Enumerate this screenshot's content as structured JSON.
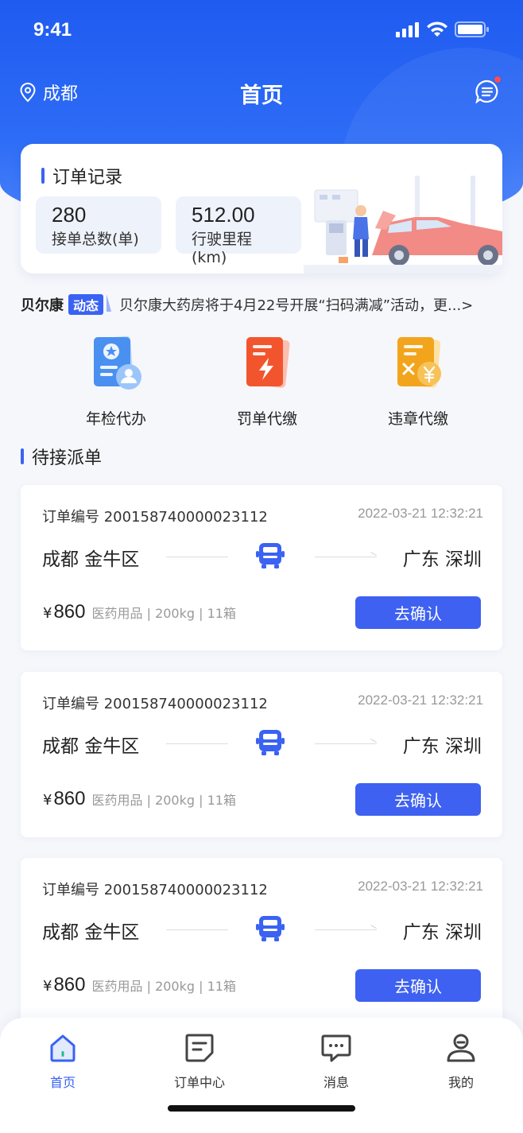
{
  "status": {
    "time": "9:41"
  },
  "nav": {
    "location": "成都",
    "title": "首页"
  },
  "record": {
    "title": "订单记录",
    "stats": [
      {
        "value": "280",
        "label": "接单总数(单)"
      },
      {
        "value": "512.00",
        "label": "行驶里程(km)"
      }
    ]
  },
  "ticker": {
    "brand": "贝尔康",
    "tag": "动态",
    "text": "贝尔康大药房将于4月22号开展“扫码满减”活动，更...>"
  },
  "services": [
    {
      "label": "年检代办",
      "icon": "annual-inspection-icon",
      "color": "#4a90f0"
    },
    {
      "label": "罚单代缴",
      "icon": "fine-payment-icon",
      "color": "#f2552d"
    },
    {
      "label": "违章代缴",
      "icon": "violation-payment-icon",
      "color": "#f2a51c"
    }
  ],
  "pending": {
    "title": "待接派单",
    "orders": [
      {
        "no": "订单编号 200158740000023112",
        "time": "2022-03-21 12:32:21",
        "from": "成都 金牛区",
        "to": "广东 深圳",
        "yen": "¥",
        "amount": "860",
        "meta": "医药用品 | 200kg | 11箱",
        "button": "去确认"
      },
      {
        "no": "订单编号 200158740000023112",
        "time": "2022-03-21 12:32:21",
        "from": "成都 金牛区",
        "to": "广东 深圳",
        "yen": "¥",
        "amount": "860",
        "meta": "医药用品 | 200kg | 11箱",
        "button": "去确认"
      },
      {
        "no": "订单编号 200158740000023112",
        "time": "2022-03-21 12:32:21",
        "from": "成都 金牛区",
        "to": "广东 深圳",
        "yen": "¥",
        "amount": "860",
        "meta": "医药用品 | 200kg | 11箱",
        "button": "去确认"
      }
    ]
  },
  "tabbar": {
    "tabs": [
      {
        "label": "首页",
        "icon": "home-icon",
        "active": true
      },
      {
        "label": "订单中心",
        "icon": "order-center-icon",
        "active": false
      },
      {
        "label": "消息",
        "icon": "message-icon",
        "active": false
      },
      {
        "label": "我的",
        "icon": "profile-icon",
        "active": false
      }
    ]
  },
  "colors": {
    "primary": "#3a63f3",
    "header": "#2d6cf6",
    "badge": "#ff4d4f"
  }
}
